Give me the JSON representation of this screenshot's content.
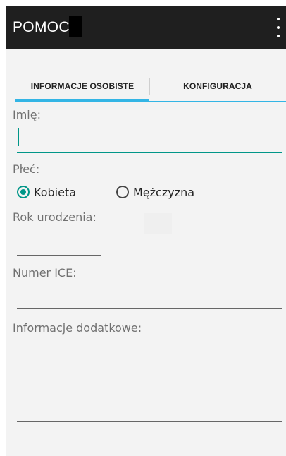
{
  "appbar": {
    "title": "POMOC",
    "menu_icon": "overflow-menu-icon"
  },
  "tabs": [
    {
      "label": "INFORMACJE OSOBISTE",
      "selected": true
    },
    {
      "label": "KONFIGURACJA",
      "selected": false
    }
  ],
  "form": {
    "name_label": "Imię:",
    "name_value": "",
    "gender_label": "Płeć:",
    "gender_options": [
      {
        "label": "Kobieta",
        "checked": true
      },
      {
        "label": "Mężczyzna",
        "checked": false
      }
    ],
    "year_label": "Rok urodzenia:",
    "year_value": "",
    "ice_label": "Numer ICE:",
    "ice_value": "",
    "info_label": "Informacje dodatkowe:",
    "info_value": ""
  },
  "colors": {
    "appbar": "#1f1f1f",
    "tab_indicator": "#33b5e5",
    "accent": "#009688",
    "background": "#f3f3f3"
  }
}
